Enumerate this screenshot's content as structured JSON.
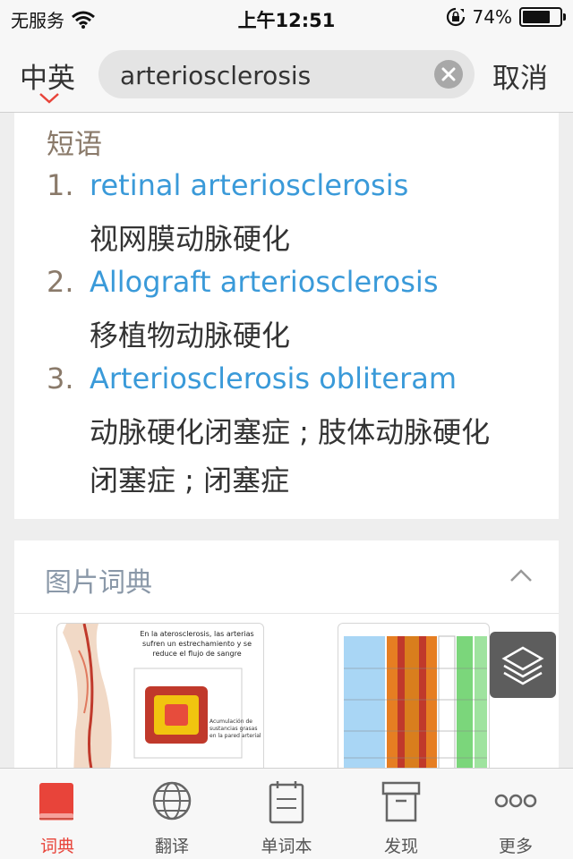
{
  "status_bar": {
    "carrier": "无服务",
    "time": "上午12:51",
    "battery": "74%",
    "battery_level": 0.74
  },
  "search": {
    "lang_toggle": "中英",
    "query": "arteriosclerosis",
    "cancel_label": "取消"
  },
  "phrases": {
    "title": "短语",
    "items": [
      {
        "num": "1.",
        "en": "retinal arteriosclerosis",
        "zh": "视网膜动脉硬化"
      },
      {
        "num": "2.",
        "en": "Allograft arteriosclerosis",
        "zh": "移植物动脉硬化"
      },
      {
        "num": "3.",
        "en": "Arteriosclerosis obliteram",
        "zh": "动脉硬化闭塞症 ; 肢体动脉硬化闭塞症 ; 闭塞症"
      }
    ]
  },
  "picture_dict": {
    "title": "图片词典",
    "image1_caption": "En la aterosclerosis, las arterias sufren un estrechamiento y se reduce el flujo de sangre",
    "image1_note": "Acumulación de sustancias grasas en la pared arterial"
  },
  "tabbar": {
    "items": [
      {
        "label": "词典",
        "icon": "dictionary-book-icon",
        "active": true
      },
      {
        "label": "翻译",
        "icon": "globe-icon",
        "active": false
      },
      {
        "label": "单词本",
        "icon": "notebook-icon",
        "active": false
      },
      {
        "label": "发现",
        "icon": "archive-box-icon",
        "active": false
      },
      {
        "label": "更多",
        "icon": "more-dots-icon",
        "active": false
      }
    ]
  },
  "colors": {
    "accent_red": "#e8443a",
    "link_blue": "#3a9ad9",
    "muted_brown": "#8a7a6a"
  }
}
